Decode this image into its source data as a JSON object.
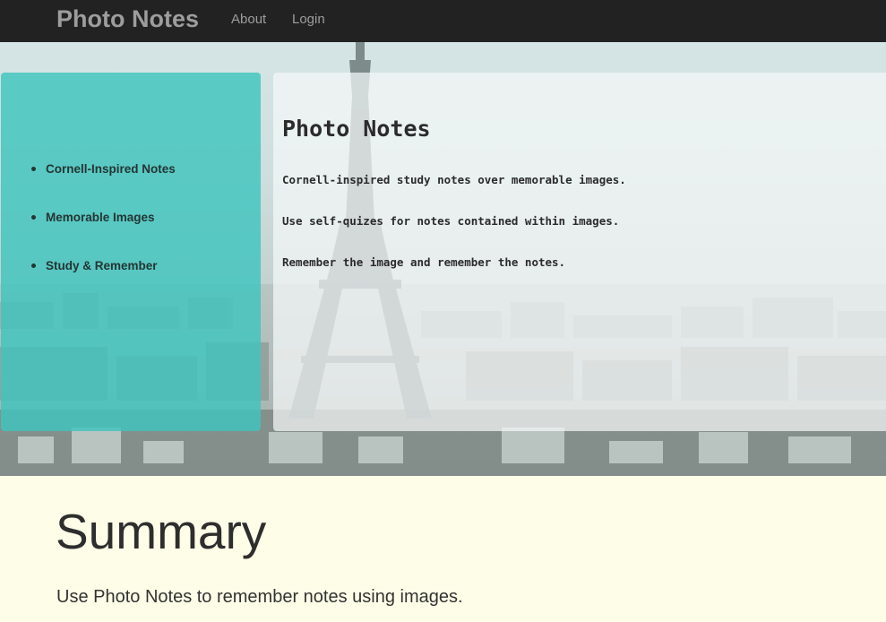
{
  "navbar": {
    "brand": "Photo Notes",
    "links": [
      {
        "label": "About"
      },
      {
        "label": "Login"
      }
    ],
    "background": "#222222",
    "text_color": "#9d9d9d"
  },
  "hero": {
    "background_image": "paris-eiffel-tower-icon",
    "sidebar": {
      "background": "#40c4be",
      "items": [
        {
          "label": "Cornell-Inspired Notes"
        },
        {
          "label": "Memorable Images"
        },
        {
          "label": "Study & Remember"
        }
      ]
    },
    "content": {
      "title": "Photo Notes",
      "lines": [
        "Cornell-inspired study notes over memorable images.",
        "Use self-quizes for notes contained within images.",
        "Remember the image and remember the notes."
      ]
    }
  },
  "summary": {
    "heading": "Summary",
    "text": "Use Photo Notes to remember notes using images.",
    "background": "#fefee8"
  }
}
